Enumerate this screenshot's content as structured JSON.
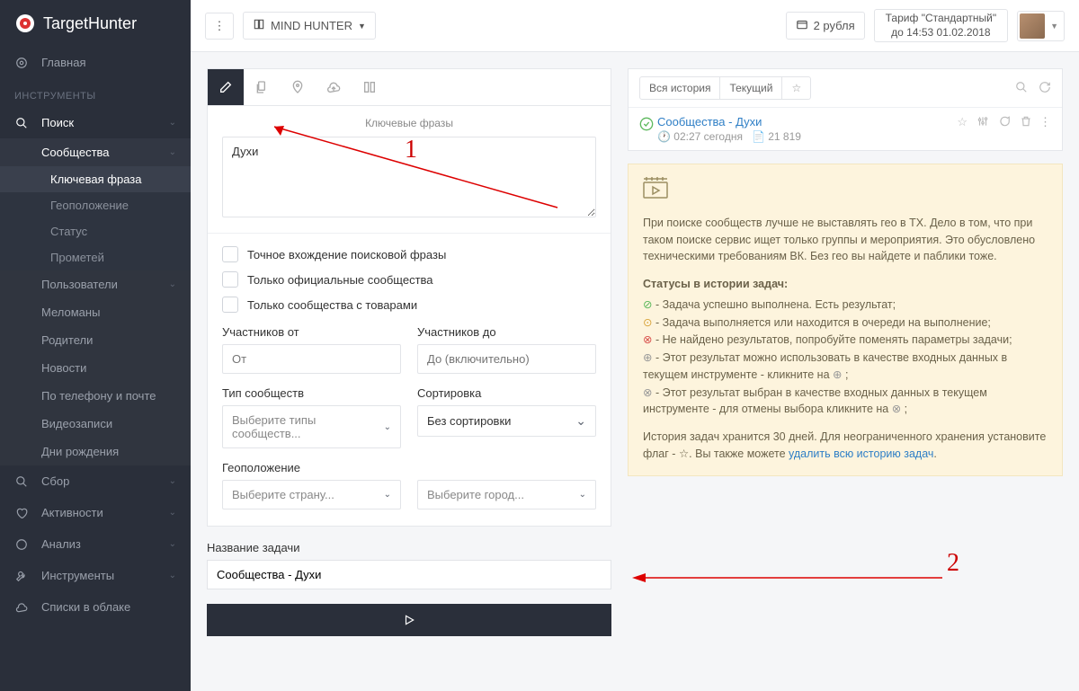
{
  "brand": {
    "name1": "Target",
    "name2": "Hunter"
  },
  "topbar": {
    "mind_hunter": "MIND HUNTER",
    "balance": "2 рубля",
    "tarif_line1": "Тариф \"Стандартный\"",
    "tarif_line2": "до 14:53 01.02.2018"
  },
  "sidebar": {
    "home": "Главная",
    "section_tools": "ИНСТРУМЕНТЫ",
    "search": "Поиск",
    "communities": "Сообщества",
    "sub": {
      "keyphrase": "Ключевая фраза",
      "geo": "Геоположение",
      "status": "Статус",
      "prometei": "Прометей"
    },
    "users": "Пользователи",
    "meloman": "Меломаны",
    "parents": "Родители",
    "news": "Новости",
    "phonemail": "По телефону и почте",
    "videos": "Видеозаписи",
    "birthdays": "Дни рождения",
    "gather": "Сбор",
    "activity": "Активности",
    "analysis": "Анализ",
    "tools": "Инструменты",
    "lists": "Списки в облаке"
  },
  "form": {
    "tab_title": "Ключевые фразы",
    "key_value": "Духи",
    "opt_exact": "Точное вхождение поисковой фразы",
    "opt_official": "Только официальные сообщества",
    "opt_goods": "Только сообщества с товарами",
    "members_from": "Участников от",
    "members_from_ph": "От",
    "members_to": "Участников до",
    "members_to_ph": "До (включительно)",
    "type": "Тип сообществ",
    "type_ph": "Выберите типы сообществ...",
    "sort": "Сортировка",
    "sort_val": "Без сортировки",
    "geo": "Геоположение",
    "geo_country_ph": "Выберите страну...",
    "geo_city_ph": "Выберите город...",
    "task_name_label": "Название задачи",
    "task_name_val": "Сообщества - Духи"
  },
  "history": {
    "tab_all": "Вся история",
    "tab_current": "Текущий",
    "item": {
      "title": "Сообщества - Духи",
      "time": "02:27 сегодня",
      "count": "21 819"
    }
  },
  "tip": {
    "para": "При поиске сообществ лучше не выставлять гео в TX. Дело в том, что при таком поиске сервис ищет только группы и мероприятия. Это обусловлено техническими требованиям ВК. Без гео вы найдете и паблики тоже.",
    "statuses_head": "Статусы в истории задач:",
    "s1": "- Задача успешно выполнена. Есть результат;",
    "s2": "- Задача выполняется или находится в очереди на выполнение;",
    "s3": "- Не найдено результатов, попробуйте поменять параметры задачи;",
    "s4a": "- Этот результат можно использовать в качестве входных данных в текущем инструменте - кликните на ",
    "s4b": " ;",
    "s5a": "- Этот результат выбран в качестве входных данных в текущем инструменте - для отмены выбора кликните на ",
    "s5b": " ;",
    "footer1": "История задач хранится 30 дней. Для неограниченного хранения установите флаг - ",
    "footer2": ". Вы также можете ",
    "delete_link": "удалить всю историю задач",
    "footer3": "."
  },
  "anno": {
    "one": "1",
    "two": "2"
  }
}
